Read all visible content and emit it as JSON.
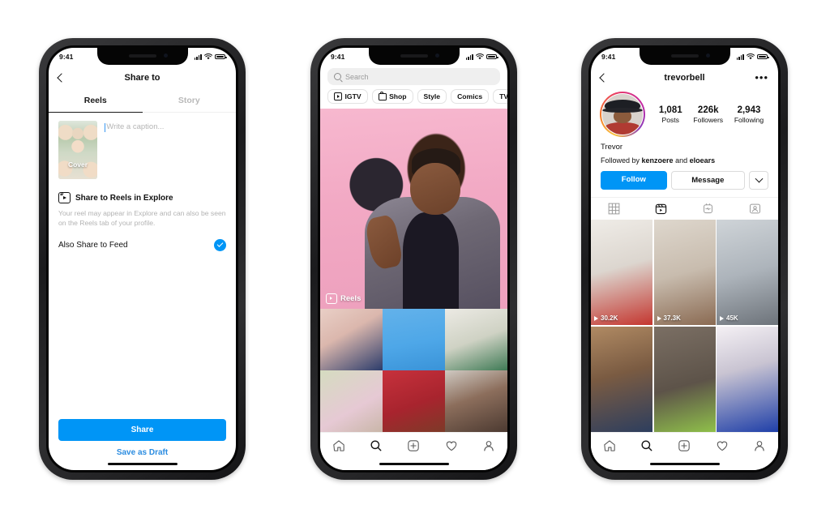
{
  "status_bar": {
    "time": "9:41"
  },
  "phone1": {
    "nav": {
      "title": "Share to",
      "back_icon": "chevron-left-icon"
    },
    "tabs": [
      {
        "label": "Reels",
        "active": true
      },
      {
        "label": "Story",
        "active": false
      }
    ],
    "cover": {
      "label": "Cover"
    },
    "caption": {
      "placeholder": "Write a caption..."
    },
    "explore": {
      "icon": "reels-icon",
      "title": "Share to Reels in Explore",
      "description": "Your reel may appear in Explore and can also be seen on the Reels tab of your profile."
    },
    "also_share": {
      "label": "Also Share to Feed",
      "checked": true,
      "check_icon": "check-circle-icon"
    },
    "share_button": "Share",
    "draft_button": "Save as Draft",
    "accent": "#0095F6"
  },
  "phone2": {
    "search": {
      "placeholder": "Search",
      "icon": "search-icon"
    },
    "chips": [
      {
        "label": "IGTV",
        "icon": "igtv-icon"
      },
      {
        "label": "Shop",
        "icon": "shopping-bag-icon"
      },
      {
        "label": "Style",
        "icon": ""
      },
      {
        "label": "Comics",
        "icon": ""
      },
      {
        "label": "TV & Movies",
        "icon": ""
      }
    ],
    "hero": {
      "badge_label": "Reels",
      "badge_icon": "reels-icon",
      "background": "#F2A9C4"
    },
    "grid": [
      {
        "name": "couple-reading-thumb",
        "colors": [
          "#e7cfc6",
          "#2c3c6b"
        ]
      },
      {
        "name": "glitter-hand-thumb",
        "colors": [
          "#4ea7e8",
          "#7b4a32"
        ]
      },
      {
        "name": "fashion-pose-thumb",
        "colors": [
          "#e7e2da",
          "#3f7a55"
        ]
      },
      {
        "name": "flowers-thumb",
        "colors": [
          "#cfd6b8",
          "#e6c9d4"
        ]
      },
      {
        "name": "red-jacket-thumb",
        "colors": [
          "#b3242f",
          "#7d3a28"
        ]
      },
      {
        "name": "portrait-thumb",
        "colors": [
          "#6e5548",
          "#cfc9c2"
        ]
      }
    ],
    "tabbar": [
      {
        "icon": "home-icon",
        "active": false
      },
      {
        "icon": "search-icon",
        "active": true
      },
      {
        "icon": "add-post-icon",
        "active": false
      },
      {
        "icon": "heart-icon",
        "active": false
      },
      {
        "icon": "profile-icon",
        "active": false
      }
    ]
  },
  "phone3": {
    "nav": {
      "back_icon": "chevron-left-icon",
      "title": "trevorbell",
      "menu_icon": "more-options-icon"
    },
    "avatar": {
      "name": "avatar",
      "has_story_ring": true
    },
    "stats": [
      {
        "num": "1,081",
        "label": "Posts"
      },
      {
        "num": "226k",
        "label": "Followers"
      },
      {
        "num": "2,943",
        "label": "Following"
      }
    ],
    "bio": {
      "name": "Trevor"
    },
    "followed_by": {
      "prefix": "Followed by ",
      "first": "kenzoere",
      "joiner": " and ",
      "second": "eloears"
    },
    "actions": {
      "follow": "Follow",
      "message": "Message",
      "more_icon": "chevron-down-icon"
    },
    "profile_tabs": [
      {
        "icon": "grid-icon",
        "active": false
      },
      {
        "icon": "reels-icon",
        "active": true
      },
      {
        "icon": "guides-icon",
        "active": false
      },
      {
        "icon": "tagged-icon",
        "active": false
      }
    ],
    "reels": [
      {
        "views": "30.2K",
        "name": "spiderman-reel",
        "colors": [
          "#e9e6e1",
          "#c4362f"
        ]
      },
      {
        "views": "37.3K",
        "name": "workout-reel",
        "colors": [
          "#d8d2c8",
          "#e8488e"
        ]
      },
      {
        "views": "45K",
        "name": "bus-reel",
        "colors": [
          "#b9bec4",
          "#f0a22a"
        ]
      },
      {
        "views": "",
        "name": "talking-head-reel",
        "colors": [
          "#9a7a5c",
          "#2d3e5e"
        ]
      },
      {
        "views": "",
        "name": "gym-jump-reel",
        "colors": [
          "#6d6158",
          "#8fc04a"
        ]
      },
      {
        "views": "",
        "name": "superman-reel",
        "colors": [
          "#f2eef2",
          "#1f3fa8"
        ]
      }
    ],
    "tabbar": [
      {
        "icon": "home-icon",
        "active": false
      },
      {
        "icon": "search-icon",
        "active": false
      },
      {
        "icon": "add-post-icon",
        "active": false
      },
      {
        "icon": "heart-icon",
        "active": false
      },
      {
        "icon": "profile-icon",
        "active": true
      }
    ],
    "accent": "#0095F6"
  }
}
